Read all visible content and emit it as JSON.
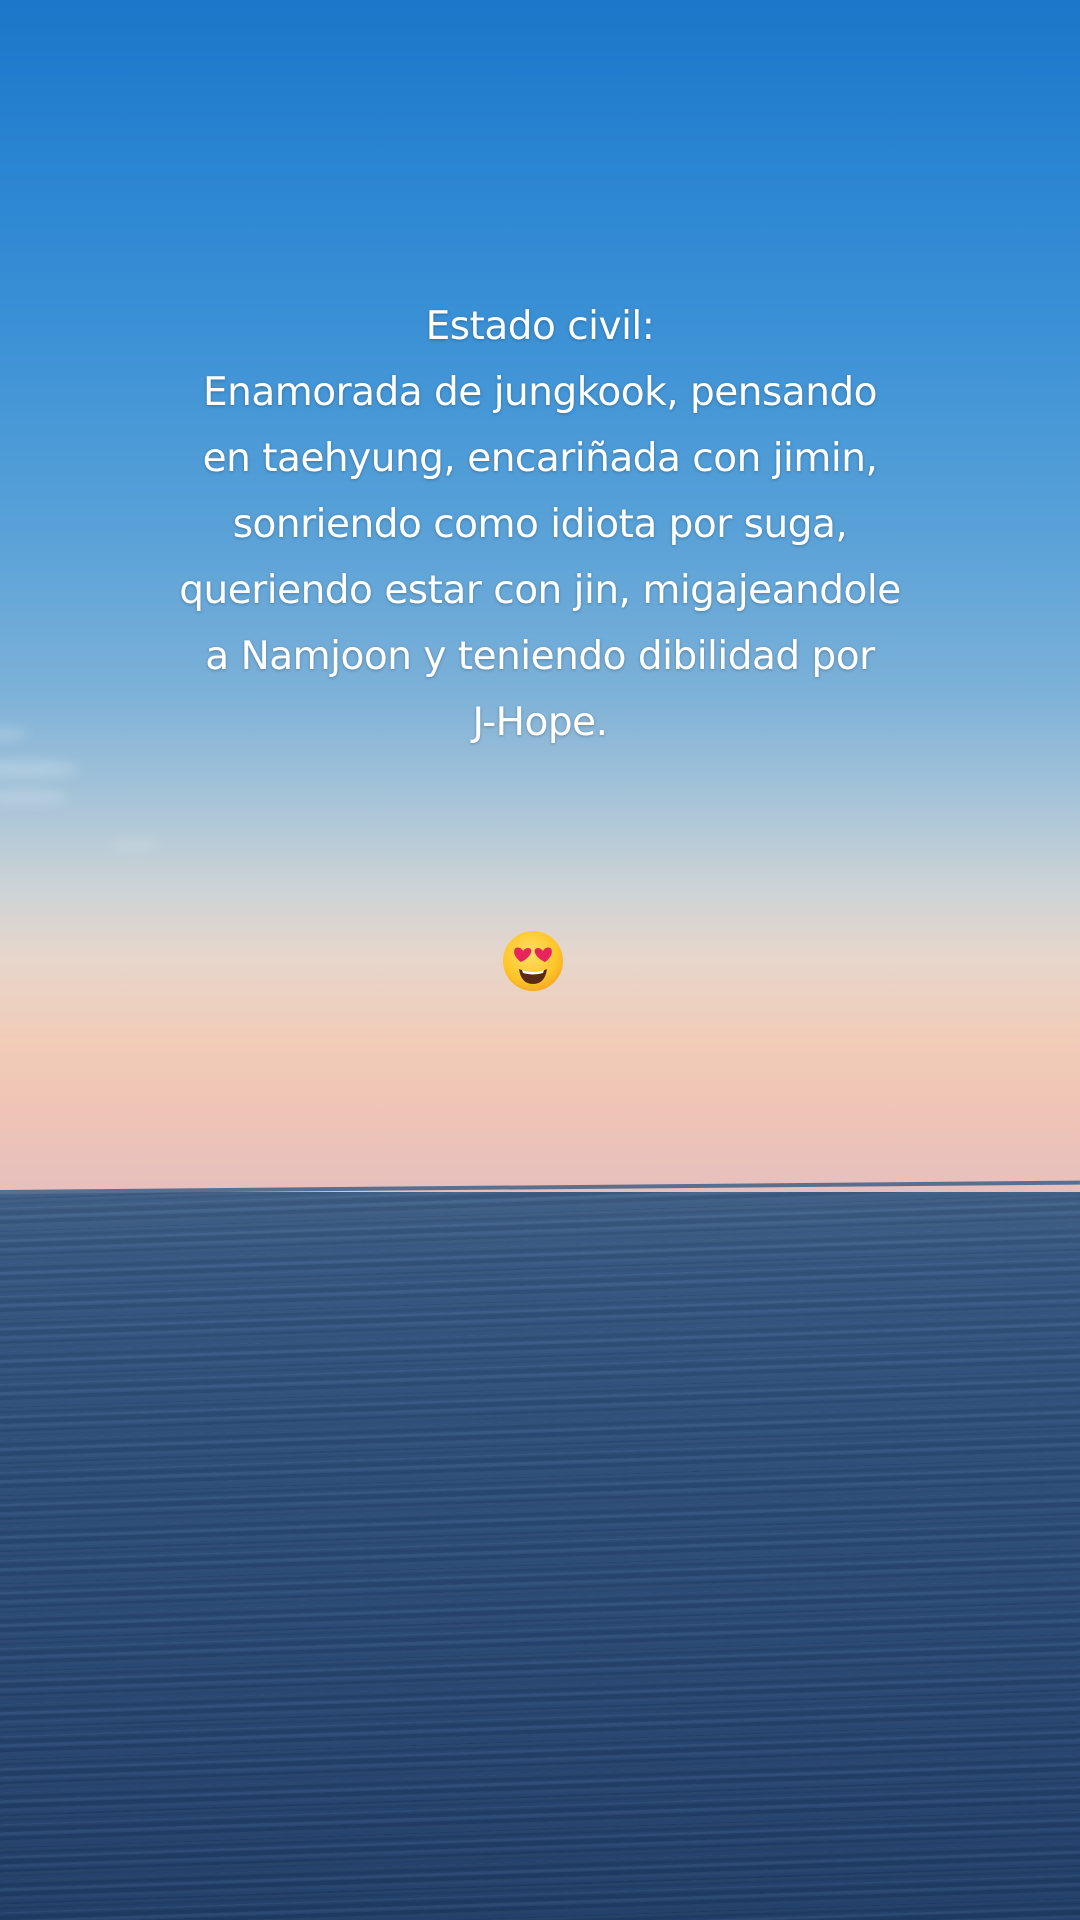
{
  "caption": {
    "lines": [
      "Estado civil:",
      "Enamorada de jungkook, pensando",
      "en taehyung, encariñada con jimin,",
      "sonriendo como idiota por suga,",
      "queriendo estar con jin, migajeandole",
      "a Namjoon y teniendo dibilidad por",
      "J-Hope."
    ]
  },
  "emoji": {
    "icon": "heart-eyes-smiling-face-icon",
    "colors": {
      "face": "#ffcc33",
      "hearts": "#e8245c",
      "mouth": "#5a2a14"
    }
  },
  "scene": {
    "sky_top": "#1c76c9",
    "horizon_glow": "#f1ccb7",
    "sea": "#264671"
  }
}
